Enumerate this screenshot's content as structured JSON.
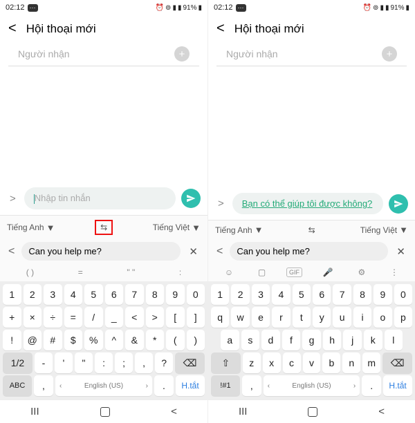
{
  "statusbar": {
    "time": "02:12",
    "battery": "91%"
  },
  "header": {
    "title": "Hội thoại mới"
  },
  "recipient": {
    "placeholder": "Người nhận",
    "add_icon": "+"
  },
  "composer": {
    "left_placeholder": "Nhập tin nhắn",
    "right_translated": "Bạn có thể giúp tôi được không?"
  },
  "lang": {
    "source": "Tiếng Anh",
    "target": "Tiếng Việt",
    "caret": "▼",
    "swap": "⇆"
  },
  "translate_input": {
    "text": "Can you help me?"
  },
  "symbol_suggest": [
    "( )",
    "=",
    "\"  \"",
    ":"
  ],
  "toolbar": {
    "emoji": "emoji",
    "sticker": "sticker",
    "gif": "GIF",
    "voice": "voice",
    "settings": "settings"
  },
  "keys_sym": {
    "r1": [
      "1",
      "2",
      "3",
      "4",
      "5",
      "6",
      "7",
      "8",
      "9",
      "0"
    ],
    "r2": [
      "+",
      "×",
      "÷",
      "=",
      "/",
      "_",
      "<",
      ">",
      "[",
      "]"
    ],
    "r3": [
      "!",
      "@",
      "#",
      "$",
      "%",
      "^",
      "&",
      "*",
      "(",
      ")"
    ],
    "r4": {
      "shift": "1/2",
      "mid": [
        "-",
        "'",
        "\"",
        ":",
        ";",
        ",",
        "?"
      ],
      "bksp": "⌫"
    },
    "r5": {
      "mode": "ABC",
      "comma": ",",
      "lang": "English (US)",
      "dot": ".",
      "enter": "H.tắt"
    }
  },
  "keys_qwerty": {
    "r1": [
      "1",
      "2",
      "3",
      "4",
      "5",
      "6",
      "7",
      "8",
      "9",
      "0"
    ],
    "r2": [
      "q",
      "w",
      "e",
      "r",
      "t",
      "y",
      "u",
      "i",
      "o",
      "p"
    ],
    "r3": [
      "a",
      "s",
      "d",
      "f",
      "g",
      "h",
      "j",
      "k",
      "l"
    ],
    "r4": {
      "shift": "⇧",
      "mid": [
        "z",
        "x",
        "c",
        "v",
        "b",
        "n",
        "m"
      ],
      "bksp": "⌫"
    },
    "r5": {
      "mode": "!#1",
      "comma": ",",
      "lang": "English (US)",
      "dot": ".",
      "enter": "H.tắt"
    }
  },
  "nav": {
    "recents": "III",
    "home": "◻",
    "back": "<"
  }
}
